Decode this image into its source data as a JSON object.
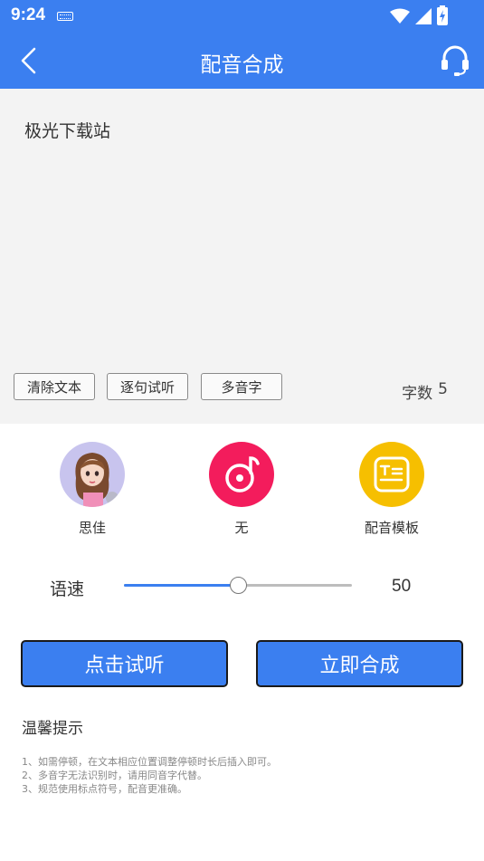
{
  "status_bar": {
    "time": "9:24"
  },
  "header": {
    "title": "配音合成"
  },
  "editor": {
    "text": "极光下载站"
  },
  "toolbar": {
    "clear_label": "清除文本",
    "sentence_label": "逐句试听",
    "polyphone_label": "多音字",
    "char_count_label": "字数",
    "char_count_value": "5"
  },
  "options": [
    {
      "label": "思佳",
      "icon": "avatar"
    },
    {
      "label": "无",
      "icon": "music-note-icon"
    },
    {
      "label": "配音模板",
      "icon": "template-icon"
    }
  ],
  "speed": {
    "label": "语速",
    "value": "50",
    "fraction": 0.5
  },
  "actions": {
    "preview_label": "点击试听",
    "synthesize_label": "立即合成"
  },
  "tips": {
    "title": "温馨提示",
    "items": [
      "1、如需停顿，在文本相应位置调整停顿时长后插入即可。",
      "2、多音字无法识别时，请用同音字代替。",
      "3、规范使用标点符号，配音更准确。"
    ]
  },
  "colors": {
    "primary": "#3b7ff0",
    "music": "#f31c5c",
    "template": "#f6bf00",
    "avatar_bg": "#c8c4ee"
  }
}
